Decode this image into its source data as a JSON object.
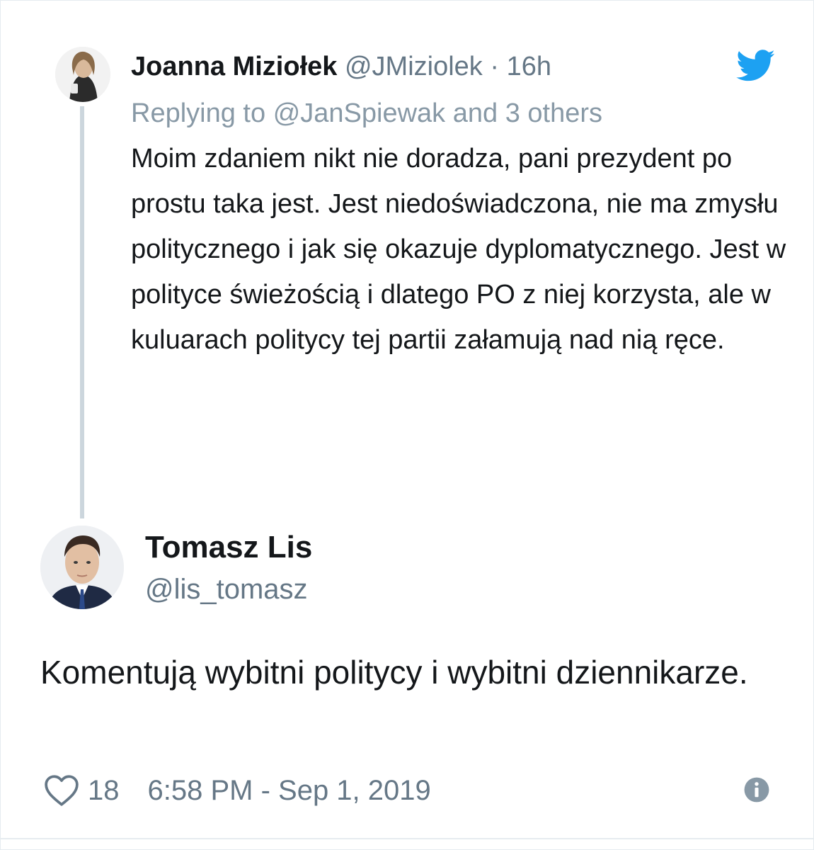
{
  "parent_tweet": {
    "author_name": "Joanna Miziołek",
    "author_handle": "@JMiziolek",
    "separator": "·",
    "time_ago": "16h",
    "replying_prefix": "Replying to",
    "replying_mention": "@JanSpiewak",
    "replying_suffix": "and 3 others",
    "text": "Moim zdaniem nikt nie doradza, pani prezydent po prostu taka jest. Jest niedoświadczona, nie ma zmysłu politycznego i jak się okazuje dyplomatycznego. Jest w polityce świeżością i dlatego PO z niej korzysta, ale w kuluarach politycy tej partii załamują nad nią ręce.",
    "avatar_icon": "user-photo",
    "brand_icon": "twitter-bird-icon"
  },
  "tweet": {
    "author_name": "Tomasz Lis",
    "author_handle": "@lis_tomasz",
    "text": "Komentują wybitni politycy i wybitni dziennikarze.",
    "avatar_icon": "user-photo"
  },
  "footer": {
    "likes": "18",
    "timestamp": "6:58 PM - Sep 1, 2019",
    "like_icon": "heart-icon",
    "info_icon": "info-icon"
  },
  "colors": {
    "twitter_blue": "#1da1f2",
    "secondary_text": "#657786",
    "thread_line": "#ccd6dd"
  }
}
